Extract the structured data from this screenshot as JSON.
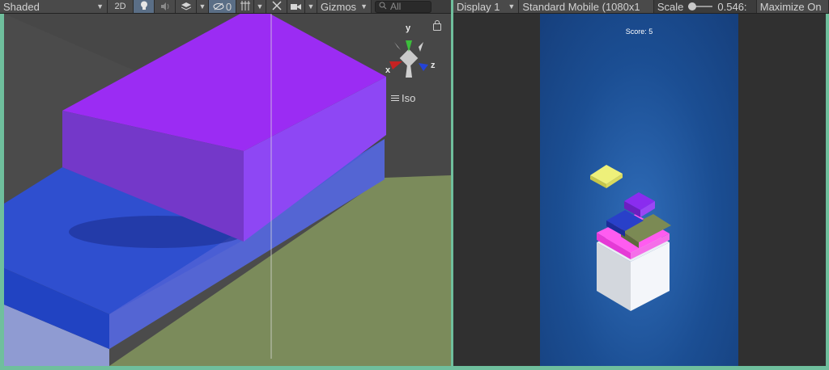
{
  "scene_toolbar": {
    "shading_mode": "Shaded",
    "mode_2d": "2D",
    "hidden_count": "0",
    "gizmos": "Gizmos",
    "search_placeholder": "All"
  },
  "game_toolbar": {
    "display": "Display 1",
    "resolution": "Standard Mobile (1080x1",
    "scale_label": "Scale",
    "scale_value": "0.546:",
    "maximize": "Maximize On"
  },
  "scene_gizmo": {
    "projection": "Iso",
    "axis_y": "y",
    "axis_x": "x",
    "axis_z": "z"
  },
  "game_view": {
    "score_text": "Score: 5"
  },
  "colors": {
    "frame_accent": "#6fbf9d",
    "purple_block": "#9b2cf3",
    "blue_block": "#2c4fd0",
    "olive_ground": "#7c8c5e",
    "game_bg": "#1b4e93"
  }
}
